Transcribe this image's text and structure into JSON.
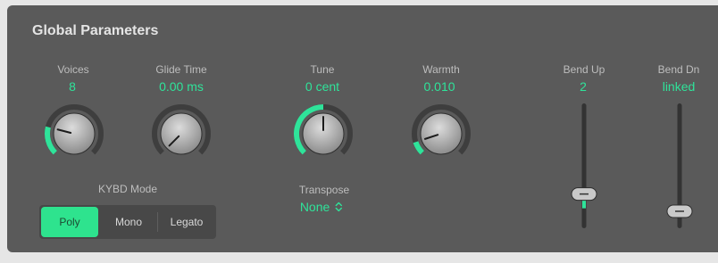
{
  "panel": {
    "title": "Global Parameters"
  },
  "knobs": {
    "voices": {
      "label": "Voices",
      "value": "8",
      "fraction": 0.22
    },
    "glide_time": {
      "label": "Glide Time",
      "value": "0.00 ms",
      "fraction": 0.0
    },
    "tune": {
      "label": "Tune",
      "value": "0 cent",
      "fraction": 0.5
    },
    "warmth": {
      "label": "Warmth",
      "value": "0.010",
      "fraction": 0.1
    }
  },
  "kybd_mode": {
    "label": "KYBD Mode",
    "options": [
      "Poly",
      "Mono",
      "Legato"
    ],
    "selected": "Poly"
  },
  "transpose": {
    "label": "Transpose",
    "value": "None",
    "icon": "up-down-chevron-icon"
  },
  "sliders": {
    "bend_up": {
      "label": "Bend Up",
      "value": "2",
      "fraction": 0.16
    },
    "bend_dn": {
      "label": "Bend Dn",
      "value": "linked",
      "fraction": 0.0
    }
  },
  "colors": {
    "accent": "#2fe39a",
    "background": "#5a5a5a",
    "label": "#bdbdbd"
  }
}
